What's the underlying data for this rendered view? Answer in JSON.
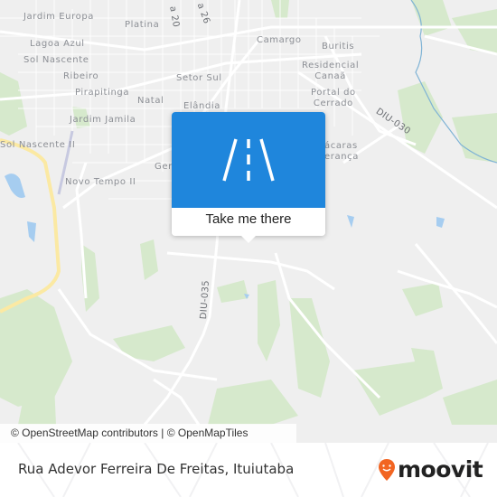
{
  "map": {
    "places": [
      {
        "id": "jardim-europa",
        "label": "Jardim Europa"
      },
      {
        "id": "platina",
        "label": "Platina"
      },
      {
        "id": "lagoa-azul",
        "label": "Lagoa Azul"
      },
      {
        "id": "sol-nascente",
        "label": "Sol Nascente"
      },
      {
        "id": "ribeiro",
        "label": "Ribeiro"
      },
      {
        "id": "pirapitinga",
        "label": "Pirapitinga"
      },
      {
        "id": "natal",
        "label": "Natal"
      },
      {
        "id": "setor-sul",
        "label": "Setor Sul"
      },
      {
        "id": "elandia",
        "label": "Elândia"
      },
      {
        "id": "jardim-jamila",
        "label": "Jardim Jamila"
      },
      {
        "id": "sol-nascente-ii",
        "label": "Sol Nascente II"
      },
      {
        "id": "novo-tempo-ii",
        "label": "Novo Tempo II"
      },
      {
        "id": "gen",
        "label": "Gen"
      },
      {
        "id": "camargo",
        "label": "Camargo"
      },
      {
        "id": "buritis",
        "label": "Buritis"
      },
      {
        "id": "residencial-canaa",
        "label": "Residencial\nCanaã"
      },
      {
        "id": "portal-do-cerrado",
        "label": "Portal do\nCerrado"
      },
      {
        "id": "chacaras-esperanca",
        "label": "ácaras\nerança"
      }
    ],
    "road_labels": [
      {
        "id": "rua-20",
        "label": "a 20"
      },
      {
        "id": "rua-26",
        "label": "a 26"
      },
      {
        "id": "diu-030",
        "label": "DIU-030"
      },
      {
        "id": "diu-035",
        "label": "DIU-035"
      }
    ],
    "attribution": "© OpenStreetMap contributors | © OpenMapTiles"
  },
  "popup": {
    "icon": "road-icon",
    "label": "Take me there",
    "color": "#1f86dc"
  },
  "footer": {
    "title": "Rua Adevor Ferreira De Freitas, Ituiutaba",
    "logo_text": "moovit",
    "logo_color": "#f26522"
  }
}
